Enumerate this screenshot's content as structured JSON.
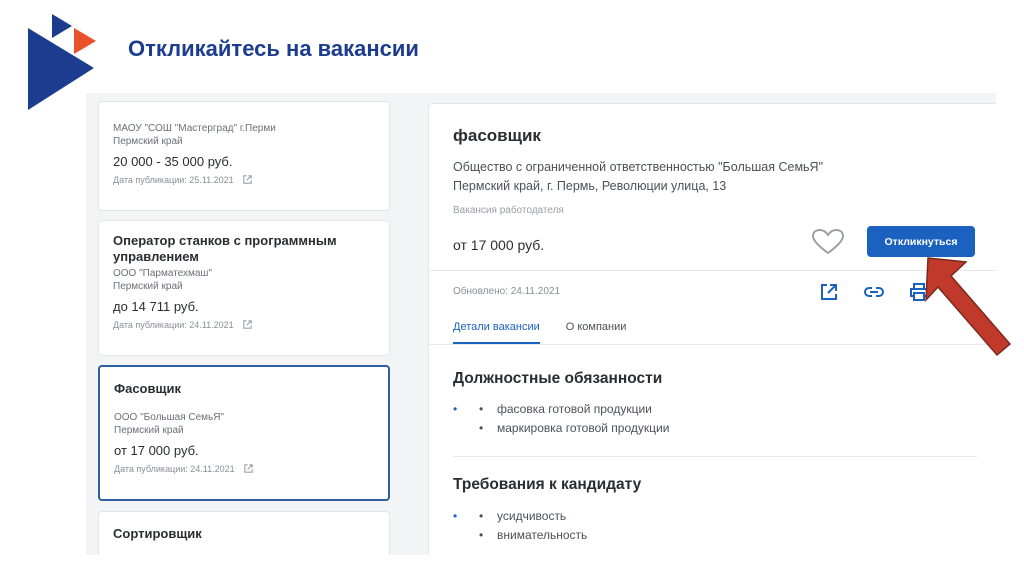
{
  "slide": {
    "title": "Откликайтесь на вакансии"
  },
  "cards": [
    {
      "company": "МАОУ \"СОШ \"Мастерград\" г.Перми",
      "region": "Пермский край",
      "salary": "20 000 - 35 000 руб.",
      "date": "Дата публикации: 25.11.2021"
    },
    {
      "title": "Оператор станков с программным управлением",
      "company": "ООО \"Парматехмаш\"",
      "region": "Пермский край",
      "salary": "до 14 711 руб.",
      "date": "Дата публикации: 24.11.2021"
    },
    {
      "title": "Фасовщик",
      "company": "ООО \"Большая СемьЯ\"",
      "region": "Пермский край",
      "salary": "от 17 000 руб.",
      "date": "Дата публикации: 24.11.2021"
    },
    {
      "title": "Сортировщик"
    }
  ],
  "detail": {
    "title": "фасовщик",
    "company": "Общество с ограниченной ответственностью \"Большая СемьЯ\"",
    "address": "Пермский край, г. Пермь, Революции улица, 13",
    "source": "Вакансия работодателя",
    "salary": "от 17 000 руб.",
    "apply_label": "Откликнуться",
    "updated": "Обновлено: 24.11.2021",
    "tabs": [
      "Детали вакансии",
      "О компании"
    ],
    "duties_heading": "Должностные обязанности",
    "duties": [
      "фасовка готовой продукции",
      "маркировка готовой продукции"
    ],
    "req_heading": "Требования к кандидату",
    "requirements": [
      "усидчивость",
      "внимательность"
    ]
  },
  "colors": {
    "brand_blue": "#1c3d8f",
    "brand_orange": "#e8512a",
    "apply_blue": "#1a61c0",
    "arrow_red": "#c0392b"
  },
  "icons": [
    "heart-icon",
    "external-link-icon",
    "link-icon",
    "print-icon"
  ]
}
